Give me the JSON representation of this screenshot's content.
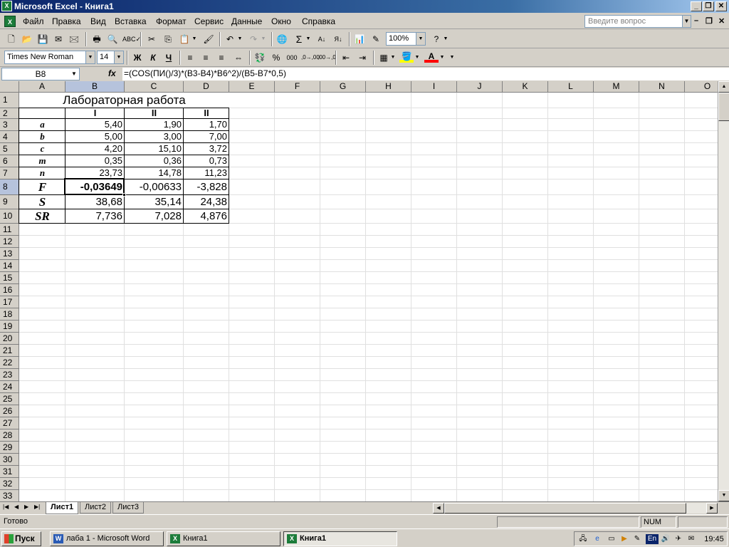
{
  "window": {
    "title": "Microsoft Excel - Книга1"
  },
  "menu": {
    "items": [
      "Файл",
      "Правка",
      "Вид",
      "Вставка",
      "Формат",
      "Сервис",
      "Данные",
      "Окно",
      "Справка"
    ],
    "help_placeholder": "Введите вопрос"
  },
  "toolbar": {
    "zoom": "100%",
    "font_name": "Times New Roman",
    "font_size": "14"
  },
  "formula_bar": {
    "name_box": "B8",
    "fx": "fx",
    "formula": "=(COS(ПИ()/3)*(B3-B4)*B6^2)/(B5-B7*0,5)"
  },
  "columns": [
    "A",
    "B",
    "C",
    "D",
    "E",
    "F",
    "G",
    "H",
    "I",
    "J",
    "K",
    "L",
    "M",
    "N",
    "O"
  ],
  "rows": [
    "1",
    "2",
    "3",
    "4",
    "5",
    "6",
    "7",
    "8",
    "9",
    "10",
    "11",
    "12",
    "13",
    "14",
    "15",
    "16",
    "17",
    "18",
    "19",
    "20",
    "21",
    "22",
    "23",
    "24",
    "25",
    "26",
    "27",
    "28",
    "29",
    "30",
    "31",
    "32",
    "33"
  ],
  "sheet": {
    "title": "Лабораторная работа",
    "headers": [
      "I",
      "II",
      "II"
    ],
    "labels": [
      "a",
      "b",
      "c",
      "m",
      "n",
      "F",
      "S",
      "SR"
    ],
    "table": [
      [
        "5,40",
        "1,90",
        "1,70"
      ],
      [
        "5,00",
        "3,00",
        "7,00"
      ],
      [
        "4,20",
        "15,10",
        "3,72"
      ],
      [
        "0,35",
        "0,36",
        "0,73"
      ],
      [
        "23,73",
        "14,78",
        "11,23"
      ],
      [
        "-0,03649",
        "-0,00633",
        "-3,828"
      ],
      [
        "38,68",
        "35,14",
        "24,38"
      ],
      [
        "7,736",
        "7,028",
        "4,876"
      ]
    ]
  },
  "tabs": [
    "Лист1",
    "Лист2",
    "Лист3"
  ],
  "status": {
    "ready": "Готово",
    "num": "NUM"
  },
  "taskbar": {
    "start": "Пуск",
    "tasks": [
      "лаба 1 - Microsoft Word",
      "Книга1",
      "Книга1"
    ],
    "lang": "En",
    "clock": "19:45"
  }
}
